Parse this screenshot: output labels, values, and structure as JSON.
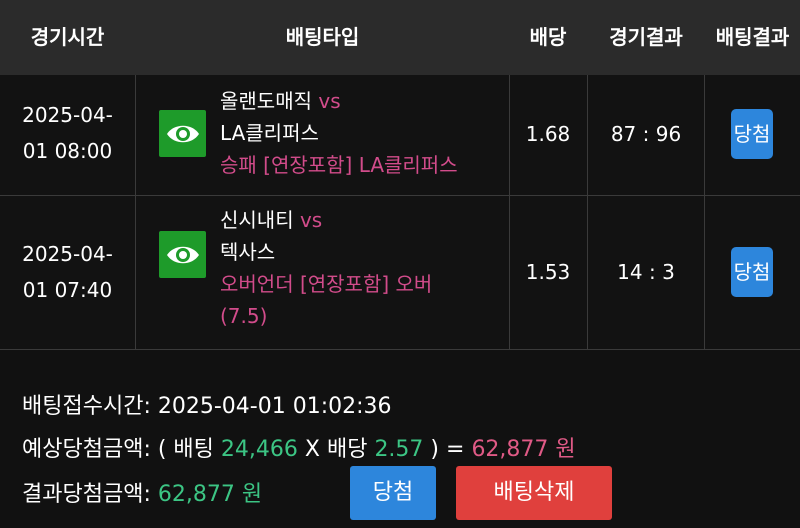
{
  "header": {
    "time": "경기시간",
    "bet_type": "배팅타입",
    "odds": "배당",
    "game_result": "경기결과",
    "bet_result": "배팅결과"
  },
  "rows": [
    {
      "date_line1": "2025-04-",
      "date_line2": "01 08:00",
      "team1": "올랜도매직",
      "vs": "vs",
      "team2": "LA클리퍼스",
      "pick": "승패 [연장포함] LA클리퍼스",
      "pick_line2": "",
      "odds": "1.68",
      "score": "87 : 96",
      "result": "당첨"
    },
    {
      "date_line1": "2025-04-",
      "date_line2": "01 07:40",
      "team1": "신시내티",
      "vs": "vs",
      "team2": "텍사스",
      "pick": "오버언더 [연장포함] 오버",
      "pick_line2": "(7.5)",
      "odds": "1.53",
      "score": "14 : 3",
      "result": "당첨"
    }
  ],
  "footer": {
    "bet_time_label": "배팅접수시간:",
    "bet_time": "2025-04-01 01:02:36",
    "expected_label": "예상당첨금액: ( 배팅",
    "bet_amount": "24,466",
    "x_label": "X 배당",
    "total_odds": "2.57",
    "eq_label": ") =",
    "expected_amount": "62,877 원",
    "result_label": "결과당첨금액:",
    "result_amount": "62,877 원",
    "win_button": "당첨",
    "delete_button": "배팅삭제"
  },
  "colors": {
    "accent_pink": "#d24c8b",
    "accent_green": "#3cc584",
    "badge_blue": "#2d86dc",
    "delete_red": "#e0403d",
    "eye_green": "#1e9b2a"
  },
  "icons": [
    "eye-icon"
  ]
}
